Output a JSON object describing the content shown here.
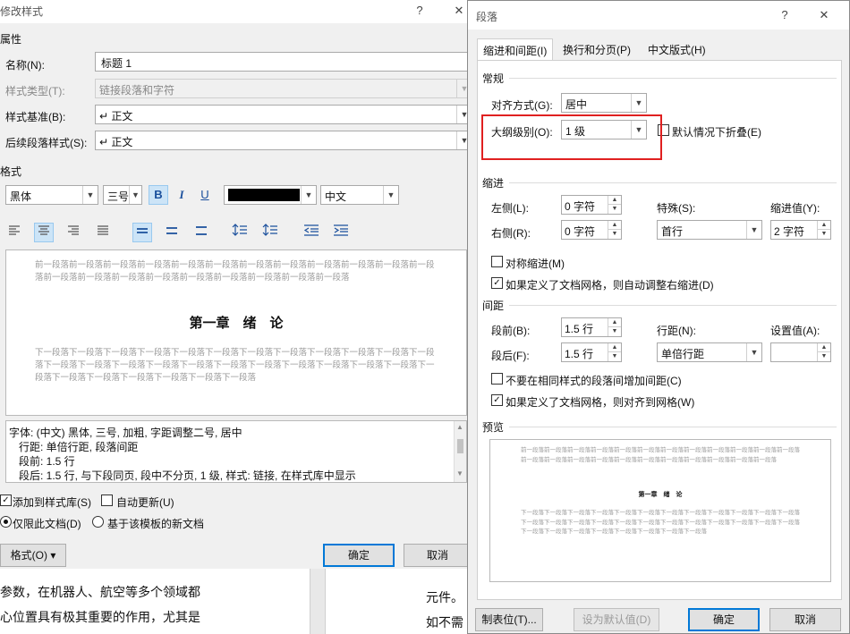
{
  "background_doc": {
    "left_line1": "参数，在机器人、航空等多个领域都",
    "left_line2": "心位置具有极其重要的作用，尤其是",
    "mid_line1": "元件。",
    "mid_line2": "如不需"
  },
  "modify_style": {
    "title": "修改样式",
    "help": "?",
    "close": "✕",
    "props_title": "属性",
    "name_label": "名称(N):",
    "name_value": "标题 1",
    "type_label": "样式类型(T):",
    "type_value": "链接段落和字符",
    "based_label": "样式基准(B):",
    "based_value": "↵ 正文",
    "next_label": "后续段落样式(S):",
    "next_value": "↵ 正文",
    "format_title": "格式",
    "font_name": "黑体",
    "font_size": "三号",
    "bold": "B",
    "italic": "I",
    "underline": "U",
    "lang": "中文",
    "font_color": "#000000",
    "prev_para": "前一段落前一段落前一段落前一段落前一段落前一段落前一段落前一段落前一段落前一段落前一段落前一段落前一段落前一段落前一段落前一段落前一段落前一段落前一段落前一段落前一段落",
    "heading": "第一章　绪　论",
    "next_para": "下一段落下一段落下一段落下一段落下一段落下一段落下一段落下一段落下一段落下一段落下一段落下一段落下一段落下一段落下一段落下一段落下一段落下一段落下一段落下一段落下一段落下一段落下一段落下一段落下一段落下一段落下一段落下一段落下一段落下一段落",
    "desc_line1": "字体: (中文) 黑体, 三号, 加粗, 字距调整二号, 居中",
    "desc_line2": "行距: 单倍行距, 段落间距",
    "desc_line3": "段前: 1.5 行",
    "desc_line4": "段后: 1.5 行, 与下段同页, 段中不分页, 1 级, 样式: 链接, 在样式库中显示",
    "add_gallery": "添加到样式库(S)",
    "auto_update": "自动更新(U)",
    "only_doc": "仅限此文档(D)",
    "new_docs": "基于该模板的新文档",
    "format_btn": "格式(O) ▾",
    "ok": "确定",
    "cancel": "取消"
  },
  "paragraph": {
    "title": "段落",
    "help": "?",
    "close": "✕",
    "tabs": [
      "缩进和间距(I)",
      "换行和分页(P)",
      "中文版式(H)"
    ],
    "general": "常规",
    "align_label": "对齐方式(G):",
    "align_value": "居中",
    "outline_label": "大纲级别(O):",
    "outline_value": "1 级",
    "collapse_label": "默认情况下折叠(E)",
    "indent": "缩进",
    "left_label": "左侧(L):",
    "left_value": "0 字符",
    "right_label": "右侧(R):",
    "right_value": "0 字符",
    "special_label": "特殊(S):",
    "special_value": "首行",
    "indent_by_label": "缩进值(Y):",
    "indent_by_value": "2 字符",
    "mirror": "对称缩进(M)",
    "auto_right": "如果定义了文档网格，则自动调整右缩进(D)",
    "spacing": "间距",
    "before_label": "段前(B):",
    "before_value": "1.5 行",
    "after_label": "段后(F):",
    "after_value": "1.5 行",
    "line_label": "行距(N):",
    "line_value": "单倍行距",
    "at_label": "设置值(A):",
    "at_value": "",
    "no_space": "不要在相同样式的段落间增加间距(C)",
    "snap_grid": "如果定义了文档网格，则对齐到网格(W)",
    "preview": "预览",
    "prev_para": "前一段落前一段落前一段落前一段落前一段落前一段落前一段落前一段落前一段落前一段落前一段落前一段落前一段落前一段落前一段落前一段落前一段落前一段落前一段落前一段落前一段落前一段落前一段落",
    "heading": "第一章　绪　论",
    "next_para": "下一段落下一段落下一段落下一段落下一段落下一段落下一段落下一段落下一段落下一段落下一段落下一段落下一段落下一段落下一段落下一段落下一段落下一段落下一段落下一段落下一段落下一段落下一段落下一段落下一段落下一段落下一段落下一段落下一段落下一段落下一段落下一段落",
    "tabs_btn": "制表位(T)...",
    "default_btn": "设为默认值(D)",
    "ok": "确定",
    "cancel": "取消"
  }
}
